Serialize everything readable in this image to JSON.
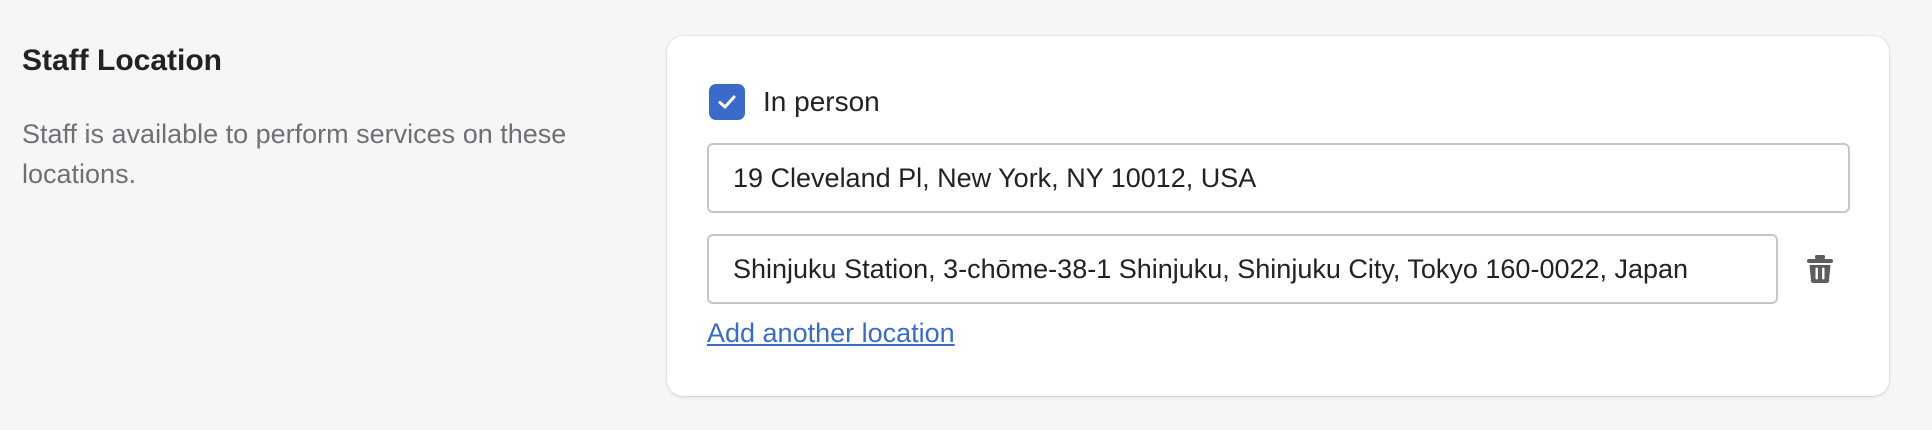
{
  "section": {
    "title": "Staff Location",
    "description": "Staff is available to perform services on these locations."
  },
  "card": {
    "in_person_label": "In person",
    "in_person_checked": true,
    "locations": [
      {
        "value": "19 Cleveland Pl, New York, NY 10012, USA",
        "placeholder": ""
      },
      {
        "value": "Shinjuku Station, 3-chōme-38-1 Shinjuku, Shinjuku City, Tokyo 160-0022, Japan",
        "placeholder": ""
      }
    ],
    "add_location_label": "Add another location",
    "delete_icon": "trash-icon"
  },
  "colors": {
    "accent": "#3a6bc9",
    "background": "#f6f6f7",
    "card": "#ffffff",
    "muted_text": "#6d7175"
  }
}
